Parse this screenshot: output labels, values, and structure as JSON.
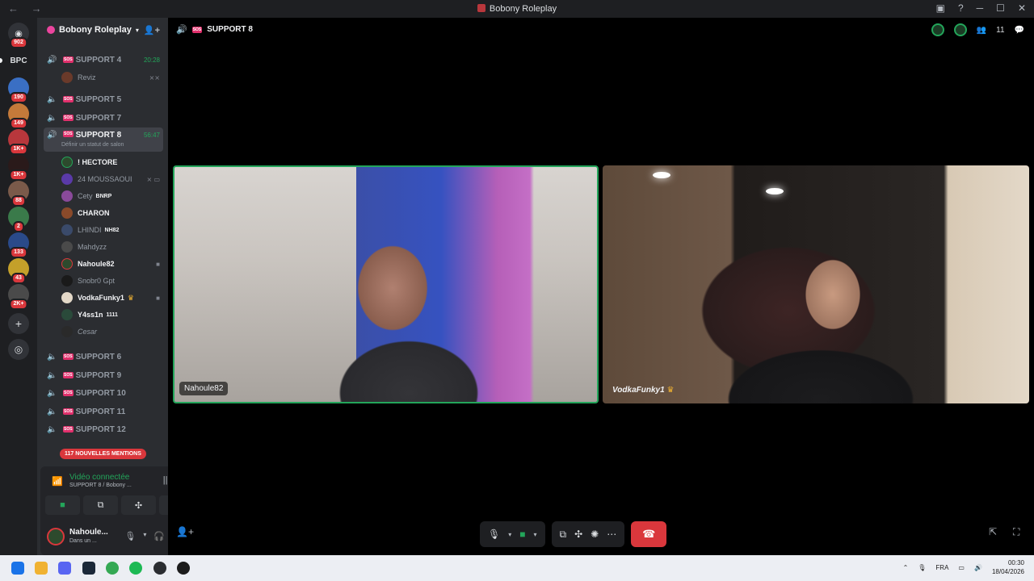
{
  "window": {
    "title": "Bobony Roleplay",
    "nav": "← →"
  },
  "rail": {
    "dm_badge": "902",
    "label_bpc": "BPC",
    "badges": [
      "190",
      "149",
      "1K+",
      "1K+",
      "88",
      "2",
      "133",
      "43",
      "2K+"
    ]
  },
  "sidebar": {
    "guild_name": "Bobony Roleplay",
    "channels_top": [
      {
        "name": "SUPPORT 4",
        "time": "20:28",
        "tag": "SOS"
      },
      {
        "name": "SUPPORT 5",
        "tag": "SOS"
      },
      {
        "name": "SUPPORT 7",
        "tag": "SOS"
      }
    ],
    "active_channel": {
      "name": "SUPPORT 8",
      "time": "56:47",
      "status": "Définir un statut de salon",
      "tag": "SOS"
    },
    "support4_user": "Reviz",
    "users": [
      {
        "name": "! HECTORE"
      },
      {
        "name": "24 MOUSSAOUI"
      },
      {
        "name": "Cety",
        "sub": "BNRP"
      },
      {
        "name": "CHARON"
      },
      {
        "name": "LHINDI",
        "sub": "NH82"
      },
      {
        "name": "Mahdyzz"
      },
      {
        "name": "Nahoule82"
      },
      {
        "name": "Snobr0 Gpt"
      },
      {
        "name": "VodkaFunky1"
      },
      {
        "name": "Y4ss1n",
        "sub": "1111"
      },
      {
        "name": "Cesar"
      }
    ],
    "channels_bottom": [
      {
        "name": "SUPPORT 6",
        "tag": "SOS"
      },
      {
        "name": "SUPPORT 9",
        "tag": "SOS"
      },
      {
        "name": "SUPPORT 10",
        "tag": "SOS"
      },
      {
        "name": "SUPPORT 11",
        "tag": "SOS"
      },
      {
        "name": "SUPPORT 12",
        "tag": "SOS"
      }
    ],
    "mentions": "117 NOUVELLES MENTIONS"
  },
  "voice": {
    "title": "Vidéo connectée",
    "sub": "SUPPORT 8 / Bobony ..."
  },
  "user_panel": {
    "name": "Nahoule...",
    "status": "Dans un ..."
  },
  "main": {
    "channel": "SUPPORT 8",
    "tag": "SOS",
    "participants": "11",
    "tiles": [
      {
        "label": "Nahoule82"
      },
      {
        "label": "VodkaFunky1"
      }
    ]
  },
  "taskbar": {
    "lang": "FRA",
    "time": "00:30",
    "date": "18/04/2026"
  },
  "colors": {
    "accent_green": "#23a55a",
    "danger_red": "#da373c",
    "sidebar": "#2b2d31",
    "rail": "#1e1f22"
  }
}
